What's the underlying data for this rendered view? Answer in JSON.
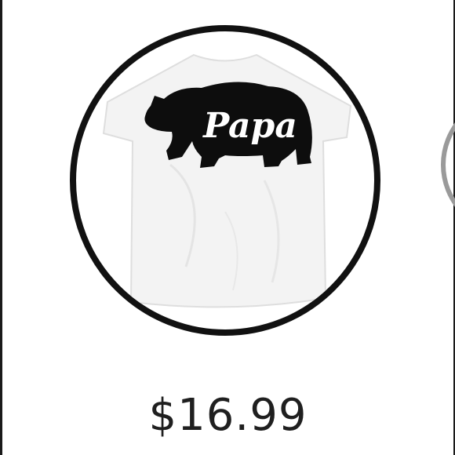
{
  "product": {
    "shirt_text": "Papa",
    "price": "$16.99"
  },
  "colors": {
    "circle_border": "#111111",
    "shirt": "#f3f3f3",
    "bear": "#0d0d0d",
    "price_text": "#1f1f1f"
  },
  "icons": {
    "next_item_peek": "partial-circle"
  }
}
